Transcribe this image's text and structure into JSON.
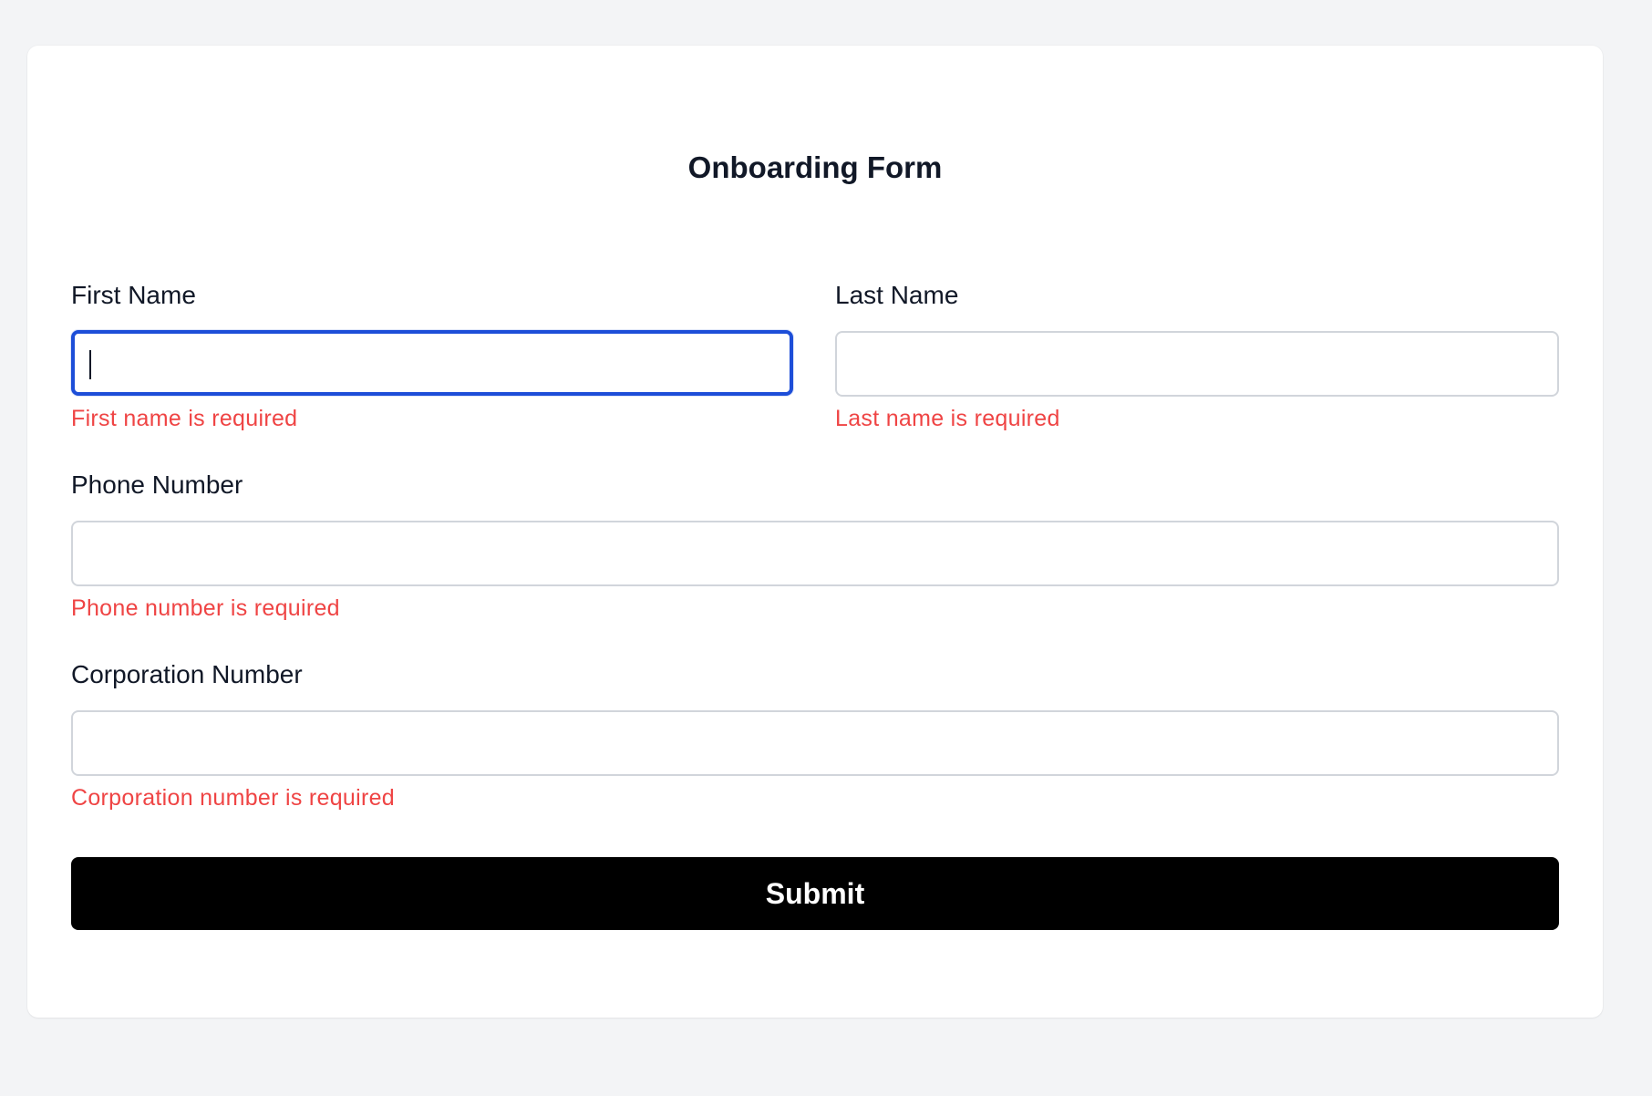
{
  "form": {
    "title": "Onboarding Form",
    "fields": {
      "first_name": {
        "label": "First Name",
        "value": "",
        "placeholder": "",
        "error": "First name is required"
      },
      "last_name": {
        "label": "Last Name",
        "value": "",
        "placeholder": "",
        "error": "Last name is required"
      },
      "phone_number": {
        "label": "Phone Number",
        "value": "",
        "placeholder": "",
        "error": "Phone number is required"
      },
      "corporation_number": {
        "label": "Corporation Number",
        "value": "",
        "placeholder": "",
        "error": "Corporation number is required"
      }
    },
    "submit_label": "Submit"
  },
  "colors": {
    "page_background": "#f3f4f6",
    "card_background": "#ffffff",
    "text": "#111827",
    "error": "#ef4444",
    "focus_border": "#1d4ed8",
    "input_border": "#d1d5db",
    "button_background": "#000000",
    "button_text": "#ffffff"
  }
}
